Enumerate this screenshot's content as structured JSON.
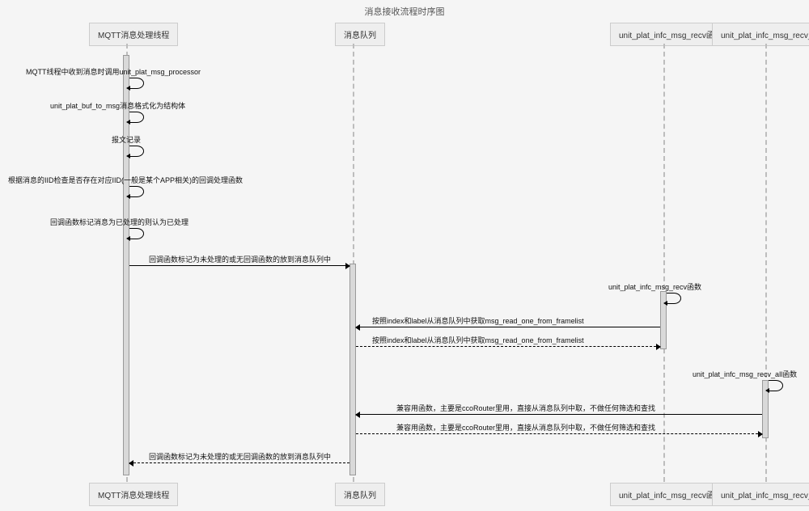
{
  "title": "消息接收流程时序图",
  "participants": {
    "p1": "MQTT消息处理线程",
    "p2": "消息队列",
    "p3": "unit_plat_infc_msg_recv函数",
    "p4": "unit_plat_infc_msg_recv_all函数"
  },
  "messages": {
    "m1": "MQTT线程中收到消息时调用unit_plat_msg_processor",
    "m2": "unit_plat_buf_to_msg消息格式化为结构体",
    "m3": "报文记录",
    "m4": "根据消息的IID检查是否存在对应IID(一般是某个APP相关)的回调处理函数",
    "m5": "回调函数标记消息为已处理的则认为已处理",
    "m6": "回调函数标记为未处理的或无回调函数的放到消息队列中",
    "m7": "unit_plat_infc_msg_recv函数",
    "m8": "按照index和label从消息队列中获取msg_read_one_from_framelist",
    "m9": "按照index和label从消息队列中获取msg_read_one_from_framelist",
    "m10": "unit_plat_infc_msg_recv_all函数",
    "m11": "兼容用函数，主要是ccoRouter里用，直接从消息队列中取，不做任何筛选和查找",
    "m12": "兼容用函数，主要是ccoRouter里用，直接从消息队列中取，不做任何筛选和查找",
    "m13": "回调函数标记为未处理的或无回调函数的放到消息队列中"
  }
}
